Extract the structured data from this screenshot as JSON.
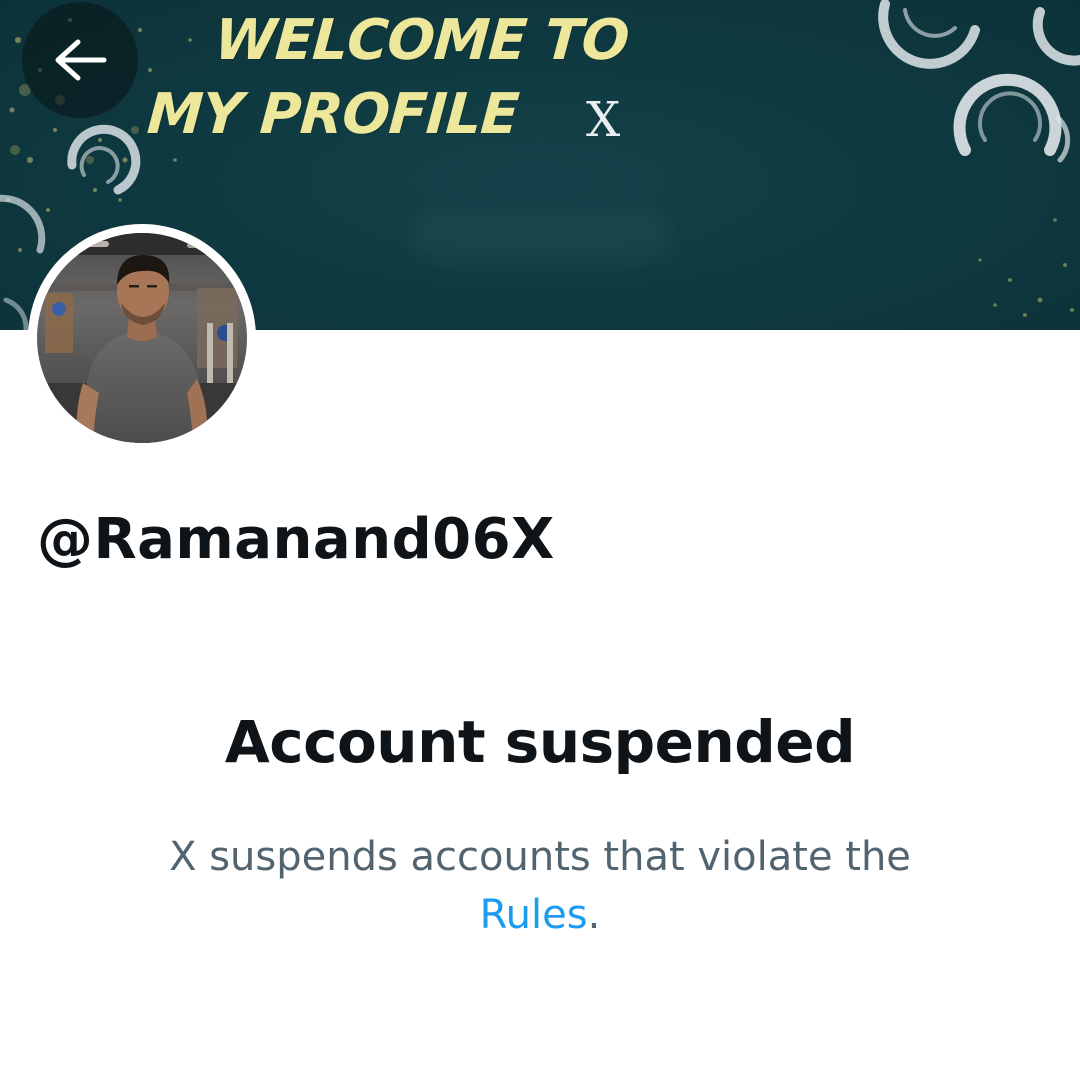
{
  "header": {
    "back_button": {
      "icon": "arrow-left-icon"
    },
    "banner": {
      "title_line1": "WELCOME TO",
      "title_line2": "MY PROFILE",
      "logo_text": "X",
      "title_color": "#ece79a",
      "background_color": "#0f3a41"
    }
  },
  "profile": {
    "avatar": {
      "description_icon": "profile-photo"
    },
    "handle": "@Ramanand06X"
  },
  "suspension": {
    "title": "Account suspended",
    "body_text": "X suspends accounts that violate the",
    "rules_link": "Rules",
    "trailing_punct": ".",
    "link_color": "#1d9bf0",
    "body_color": "#536471"
  }
}
